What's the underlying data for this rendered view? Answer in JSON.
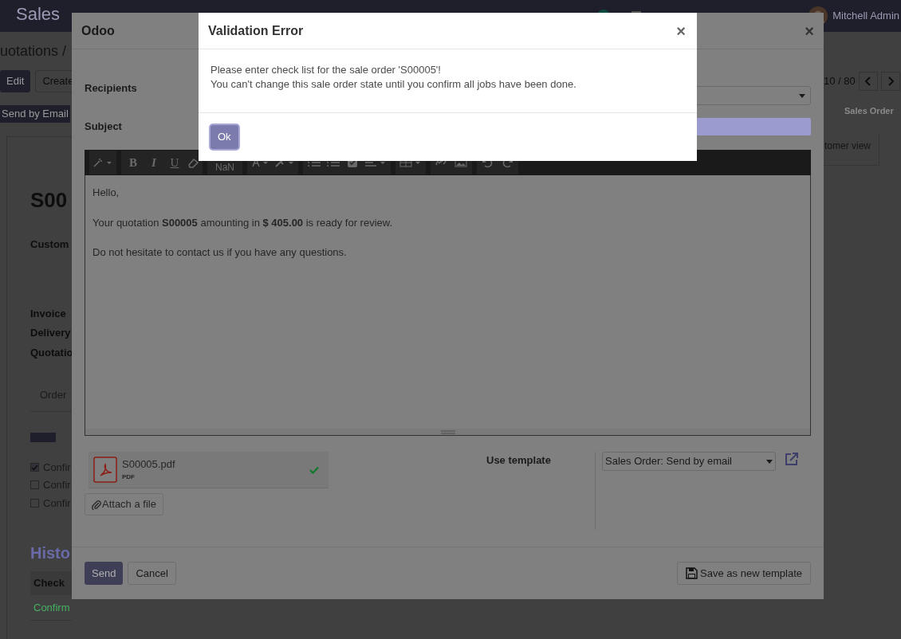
{
  "app": {
    "name": "Sales",
    "user": "Mitchell Admin"
  },
  "breadcrumb": "uotations /",
  "control_buttons": [
    {
      "label": "Edit",
      "primary": true
    },
    {
      "label": "Create",
      "primary": false
    }
  ],
  "pager": "10 / 80",
  "header_button": "Send by Email",
  "stage": "Sales Order",
  "smart_button": "tomer view",
  "record": {
    "name": "S00",
    "labels": [
      "Custom",
      "Invoice",
      "Delivery",
      "Quotatio"
    ],
    "tab": "Order"
  },
  "checklist": [
    {
      "label": "Confir",
      "checked": true
    },
    {
      "label": "Confir",
      "checked": false
    },
    {
      "label": "Confir",
      "checked": false
    }
  ],
  "history": {
    "title": "Histo",
    "column": "Check",
    "rows": [
      "Confirm"
    ]
  },
  "compose": {
    "title": "Odoo",
    "fields": [
      {
        "label": "Recipients",
        "kind": "select"
      },
      {
        "label": "Subject",
        "kind": "text"
      }
    ],
    "toolbar_text": [
      "B",
      "I",
      "U",
      "NaN"
    ],
    "body": [
      "Hello,",
      "Your quotation **S00005** amounting in **$ 405.00** is ready for review.",
      "Do not hesitate to contact us if you have any questions."
    ],
    "attachment": {
      "name": "S00005.pdf",
      "type": "PDF",
      "uploaded": true
    },
    "attach_button": "Attach a file",
    "template_label": "Use template",
    "template": "Sales Order: Send by email",
    "buttons": [
      {
        "label": "Send",
        "primary": true
      },
      {
        "label": "Cancel",
        "primary": false
      }
    ],
    "save_template": "Save as new template",
    "close": "×"
  },
  "error": {
    "title": "Validation Error",
    "close": "×",
    "lines": [
      "Please enter check list for the sale order 'S00005'!",
      "You can't change this sale order state until you confirm all jobs have been done."
    ],
    "button": "Ok"
  }
}
